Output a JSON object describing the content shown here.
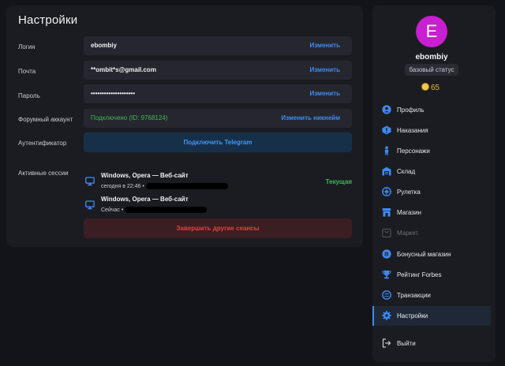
{
  "settings": {
    "title": "Настройки",
    "login": {
      "label": "Логин",
      "value": "ebombiy",
      "action": "Изменить"
    },
    "email": {
      "label": "Почта",
      "value": "**ombit*s@gmail.com",
      "action": "Изменить"
    },
    "password": {
      "label": "Пароль",
      "value": "••••••••••••••••••••",
      "action": "Изменить"
    },
    "forum": {
      "label": "Форумный аккаунт",
      "value": "Подключено (ID: 9768124)",
      "action": "Изменить никнейм"
    },
    "authenticator": {
      "label": "Аутентификатор",
      "button": "Подключить Telegram"
    },
    "sessions": {
      "label": "Активные сессии",
      "items": [
        {
          "title": "Windows, Opera — Веб-сайт",
          "time": "сегодня в 22:46 •",
          "current": "Текущая"
        },
        {
          "title": "Windows, Opera — Веб-сайт",
          "time": "Сейчас •",
          "current": ""
        }
      ],
      "end_button": "Завершить другие сеансы"
    }
  },
  "sidebar": {
    "avatar_letter": "E",
    "username": "ebombiy",
    "status": "базовый статус",
    "coins": "65",
    "items": [
      {
        "label": "Профиль",
        "icon": "user-icon"
      },
      {
        "label": "Наказания",
        "icon": "alert-icon"
      },
      {
        "label": "Персонажи",
        "icon": "character-icon"
      },
      {
        "label": "Склад",
        "icon": "warehouse-icon"
      },
      {
        "label": "Рулетка",
        "icon": "roulette-icon"
      },
      {
        "label": "Магазин",
        "icon": "shop-icon"
      },
      {
        "label": "Маркет",
        "icon": "market-icon"
      },
      {
        "label": "Бонусный магазин",
        "icon": "bonus-icon"
      },
      {
        "label": "Рейтинг Forbes",
        "icon": "trophy-icon"
      },
      {
        "label": "Транзакции",
        "icon": "transactions-icon"
      },
      {
        "label": "Настройки",
        "icon": "gear-icon"
      },
      {
        "label": "Выйти",
        "icon": "logout-icon"
      }
    ]
  },
  "colors": {
    "accent": "#3d8bf2",
    "success": "#3fba57",
    "danger": "#e8413d",
    "avatar": "#c81fd0"
  }
}
